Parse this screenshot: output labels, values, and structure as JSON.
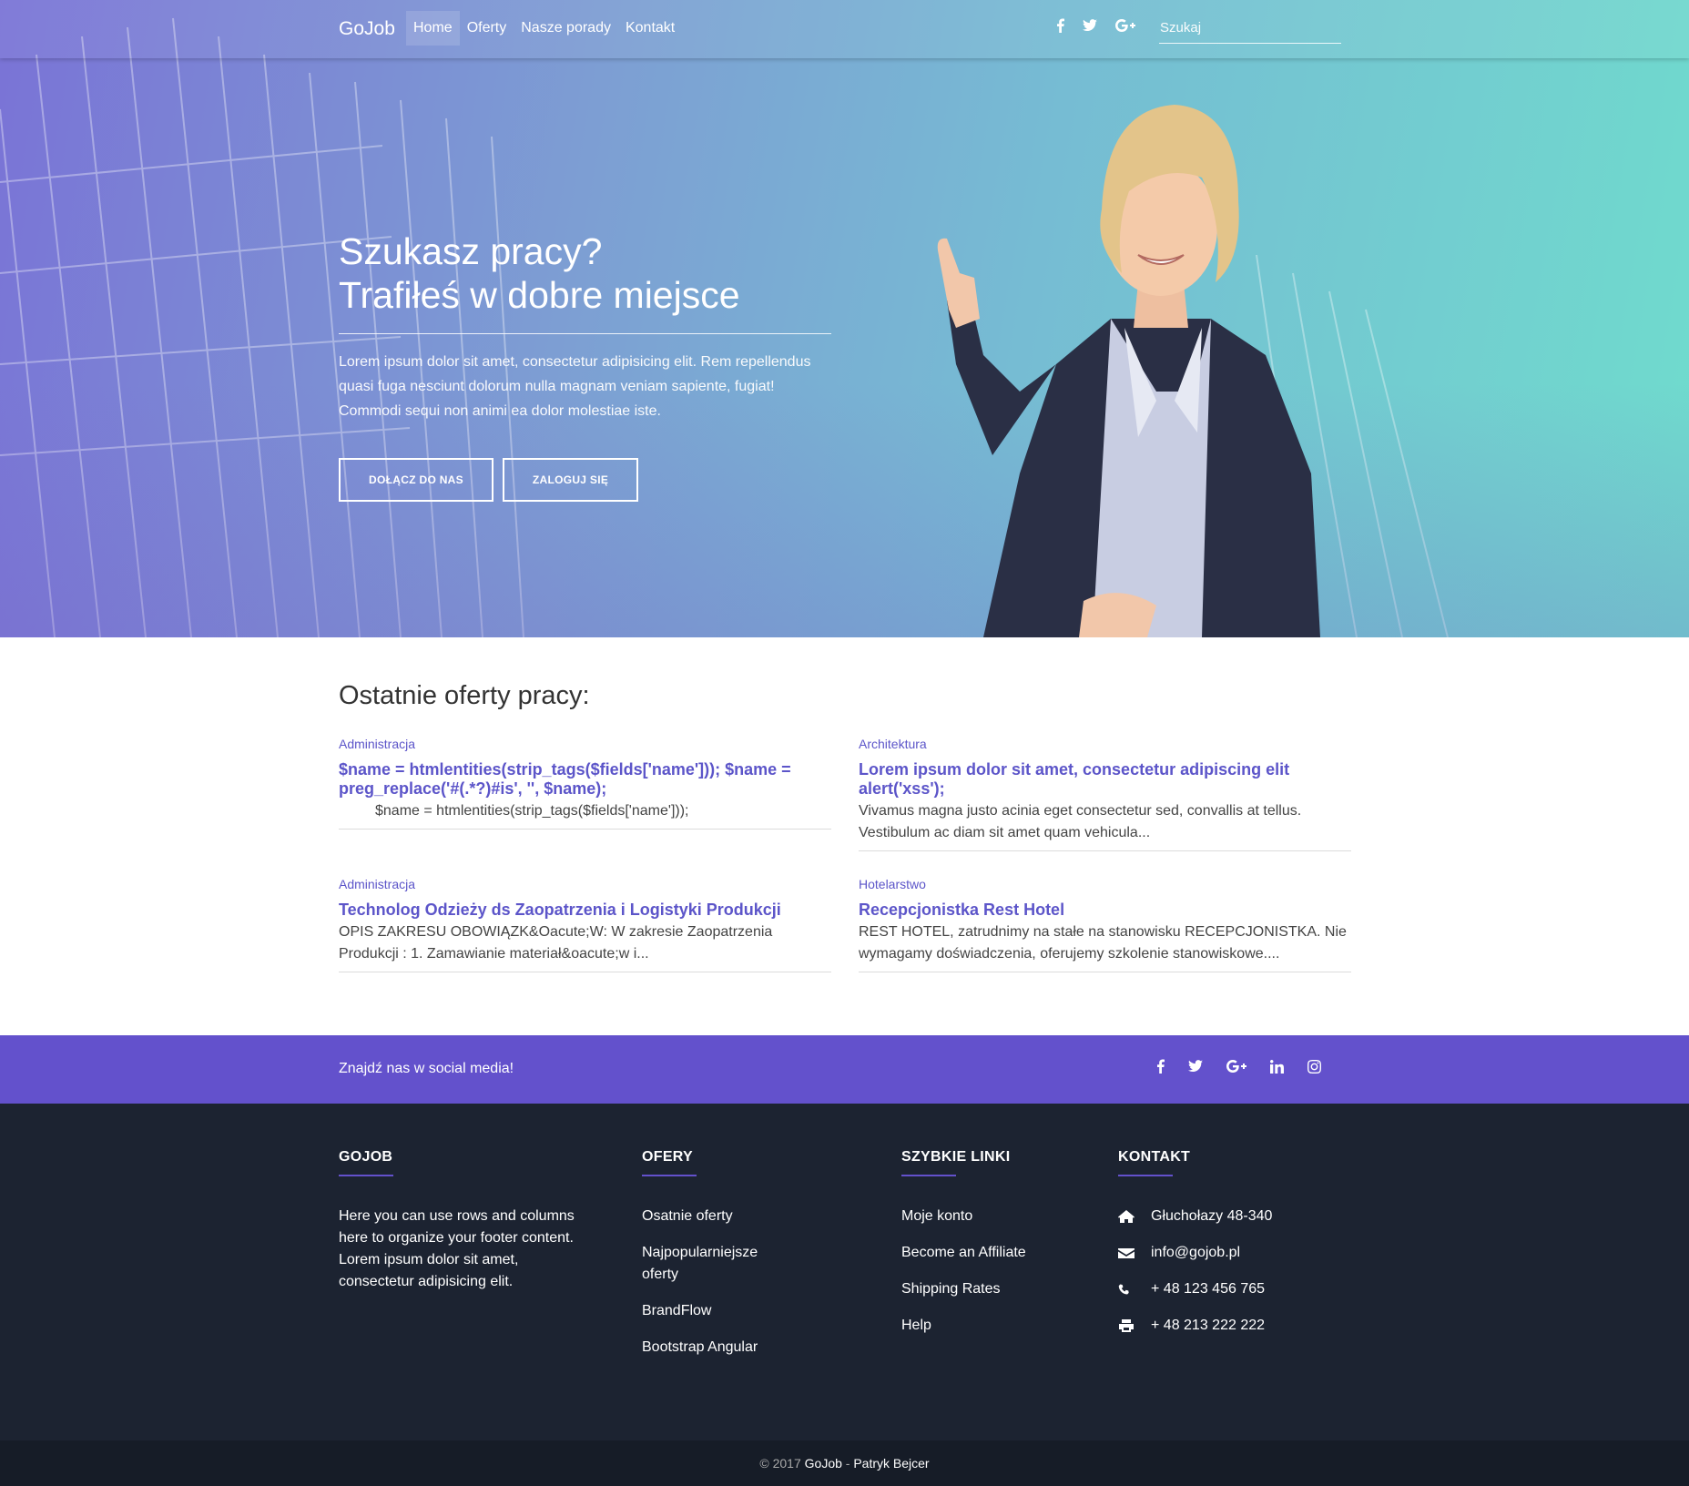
{
  "nav": {
    "brand": "GoJob",
    "links": [
      "Home",
      "Oferty",
      "Nasze porady",
      "Kontakt"
    ],
    "social_icons": [
      "facebook-icon",
      "twitter-icon",
      "google-plus-icon"
    ],
    "search_placeholder": "Szukaj"
  },
  "hero": {
    "title_line1": "Szukasz pracy?",
    "title_line2": "Trafiłeś w dobre miejsce",
    "text": "Lorem ipsum dolor sit amet, consectetur adipisicing elit. Rem repellendus quasi fuga nesciunt dolorum nulla magnam veniam sapiente, fugiat! Commodi sequi non animi ea dolor molestiae iste.",
    "btn_join": "DOŁĄCZ DO NAS",
    "btn_login": "ZALOGUJ SIĘ"
  },
  "offers": {
    "heading": "Ostatnie oferty pracy:",
    "items": [
      {
        "category": "Administracja",
        "title": "$name = htmlentities(strip_tags($fields['name'])); $name = preg_replace('#(.*?)#is', '', $name);",
        "desc": "         $name = htmlentities(strip_tags($fields['name']));"
      },
      {
        "category": "Architektura",
        "title": "Lorem ipsum dolor sit amet, consectetur adipiscing elit alert('xss');",
        "desc": "  Vivamus magna justo acinia eget consectetur sed, convallis at tellus. Vestibulum ac diam sit amet quam vehicula..."
      },
      {
        "category": "Administracja",
        "title": "Technolog Odzieży ds Zaopatrzenia i Logistyki Produkcji",
        "desc": "OPIS ZAKRESU OBOWIĄZK&Oacute;W: W zakresie Zaopatrzenia Produkcji : 1. Zamawianie materiał&oacute;w i..."
      },
      {
        "category": "Hotelarstwo",
        "title": "Recepcjonistka Rest Hotel",
        "desc": "REST HOTEL, zatrudnimy na stałe na stanowisku RECEPCJONISTKA. Nie wymagamy doświadczenia, oferujemy szkolenie stanowiskowe...."
      }
    ]
  },
  "social_bar": {
    "text": "Znajdź nas w social media!",
    "icons": [
      "facebook-icon",
      "twitter-icon",
      "google-plus-icon",
      "linkedin-icon",
      "instagram-icon"
    ]
  },
  "footer": {
    "gojob": {
      "heading": "GOJOB",
      "text": "Here you can use rows and columns here to organize your footer content. Lorem ipsum dolor sit amet, consectetur adipisicing elit."
    },
    "oferty": {
      "heading": "OFERY",
      "links": [
        "Osatnie oferty",
        "Najpopularniejsze oferty",
        "BrandFlow",
        "Bootstrap Angular"
      ]
    },
    "szybkie": {
      "heading": "SZYBKIE LINKI",
      "links": [
        "Moje konto",
        "Become an Affiliate",
        "Shipping Rates",
        "Help"
      ]
    },
    "kontakt": {
      "heading": "KONTAKT",
      "items": [
        {
          "icon": "home-icon",
          "text": "Głuchołazy 48-340"
        },
        {
          "icon": "envelope-icon",
          "text": "info@gojob.pl"
        },
        {
          "icon": "phone-icon",
          "text": "+ 48 123 456 765"
        },
        {
          "icon": "print-icon",
          "text": "+ 48 213 222 222"
        }
      ]
    }
  },
  "copyright": {
    "prefix": "© 2017 ",
    "link1": "GoJob",
    "sep": " - ",
    "link2": "Patryk Bejcer"
  },
  "colors": {
    "accent": "#6351cc",
    "link": "#5c55c9",
    "footer_bg": "#1c2331",
    "copyright_bg": "#161c27"
  }
}
